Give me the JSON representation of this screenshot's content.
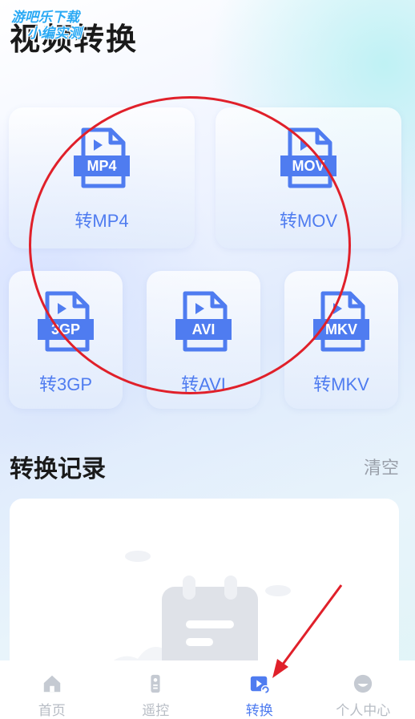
{
  "watermark": {
    "line1": "游吧乐下载",
    "line2": "小编实测"
  },
  "page_title": "视频转换",
  "converters": [
    {
      "tag": "MP4",
      "label": "转MP4"
    },
    {
      "tag": "MOV",
      "label": "转MOV"
    },
    {
      "tag": "3GP",
      "label": "转3GP"
    },
    {
      "tag": "AVI",
      "label": "转AVI"
    },
    {
      "tag": "MKV",
      "label": "转MKV"
    }
  ],
  "records": {
    "title": "转换记录",
    "clear_label": "清空"
  },
  "tabbar": {
    "items": [
      {
        "label": "首页",
        "icon": "home-icon",
        "active": false
      },
      {
        "label": "遥控",
        "icon": "remote-icon",
        "active": false
      },
      {
        "label": "转换",
        "icon": "convert-icon",
        "active": true
      },
      {
        "label": "个人中心",
        "icon": "profile-icon",
        "active": false
      }
    ]
  },
  "colors": {
    "accent": "#4f7cf0",
    "inactive": "#b7bcc4",
    "annotation": "#e0202a"
  }
}
